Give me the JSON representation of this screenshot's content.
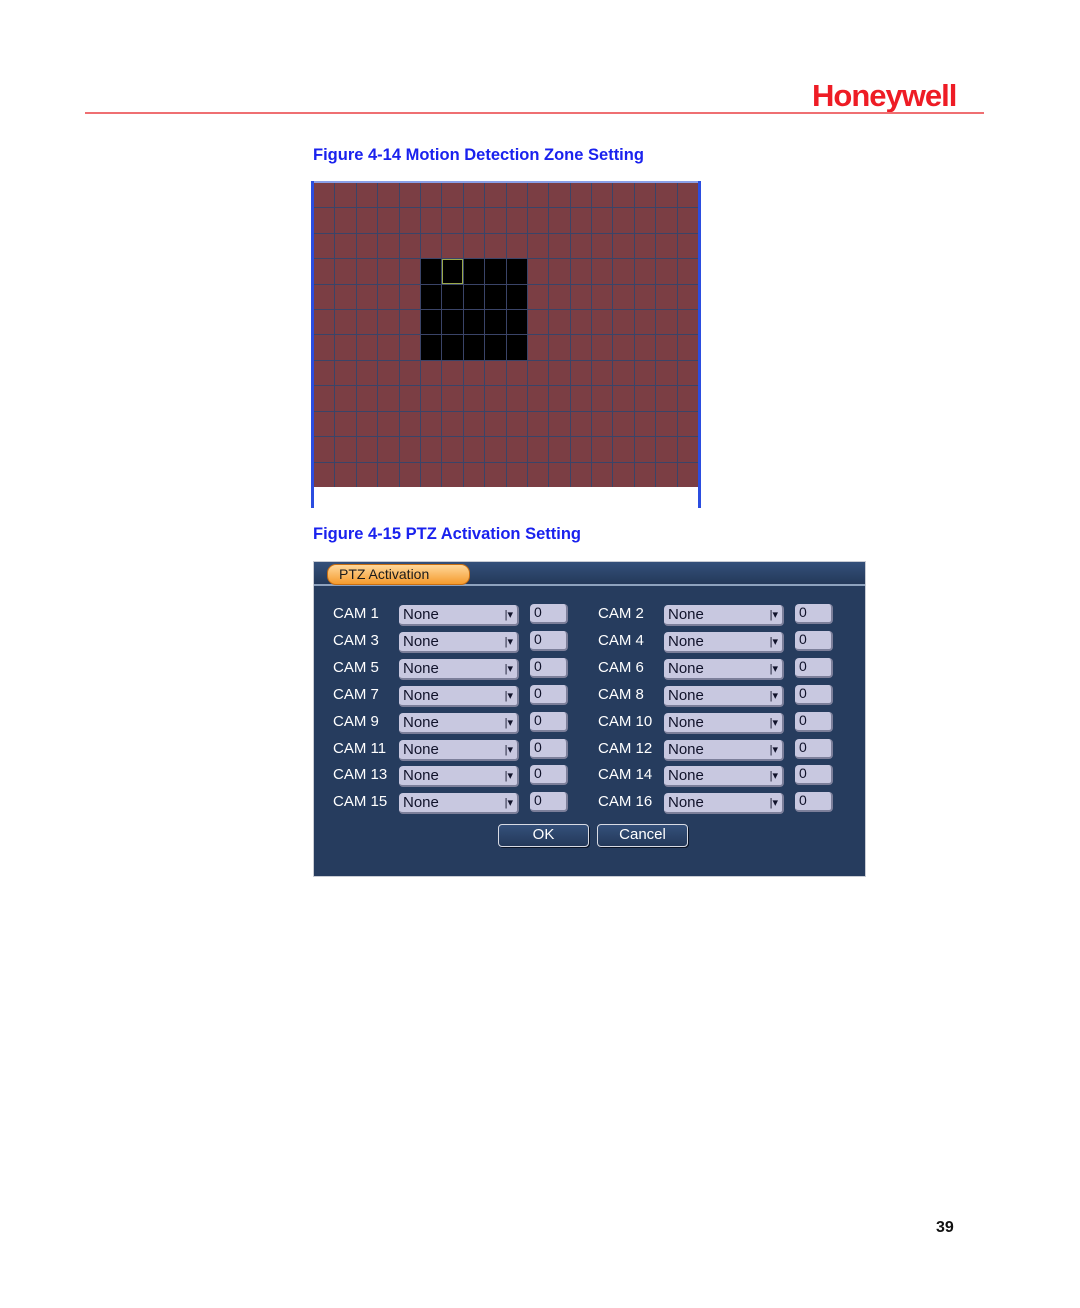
{
  "header": {
    "brand": "Honeywell",
    "brand_color": "#ee1c25",
    "rule_color": "#ef6f72"
  },
  "figure_motion": {
    "caption": "Figure 4-14 Motion Detection Zone Setting",
    "grid": {
      "columns": 18,
      "rows": 12,
      "active_color": "#7b3e44",
      "inactive_color": "#000000",
      "inactive_cells": {
        "rows": [
          3,
          4,
          5,
          6
        ],
        "columns": [
          5,
          6,
          7,
          8,
          9
        ]
      },
      "cursor_cell": {
        "row": 3,
        "column": 6
      }
    }
  },
  "figure_ptz": {
    "caption": "Figure 4-15 PTZ Activation Setting",
    "tab_label": "PTZ Activation",
    "dropdown_arrow_icon": "|▾",
    "cameras": [
      {
        "label": "CAM 1",
        "type": "None",
        "value": "0"
      },
      {
        "label": "CAM 2",
        "type": "None",
        "value": "0"
      },
      {
        "label": "CAM 3",
        "type": "None",
        "value": "0"
      },
      {
        "label": "CAM 4",
        "type": "None",
        "value": "0"
      },
      {
        "label": "CAM 5",
        "type": "None",
        "value": "0"
      },
      {
        "label": "CAM 6",
        "type": "None",
        "value": "0"
      },
      {
        "label": "CAM 7",
        "type": "None",
        "value": "0"
      },
      {
        "label": "CAM 8",
        "type": "None",
        "value": "0"
      },
      {
        "label": "CAM 9",
        "type": "None",
        "value": "0"
      },
      {
        "label": "CAM 10",
        "type": "None",
        "value": "0"
      },
      {
        "label": "CAM 11",
        "type": "None",
        "value": "0"
      },
      {
        "label": "CAM 12",
        "type": "None",
        "value": "0"
      },
      {
        "label": "CAM 13",
        "type": "None",
        "value": "0"
      },
      {
        "label": "CAM 14",
        "type": "None",
        "value": "0"
      },
      {
        "label": "CAM 15",
        "type": "None",
        "value": "0"
      },
      {
        "label": "CAM 16",
        "type": "None",
        "value": "0"
      }
    ],
    "buttons": {
      "ok": "OK",
      "cancel": "Cancel"
    },
    "panel_color": "#263c5e",
    "tab_color": "#f59b2e"
  },
  "footer": {
    "page_number": "39"
  }
}
